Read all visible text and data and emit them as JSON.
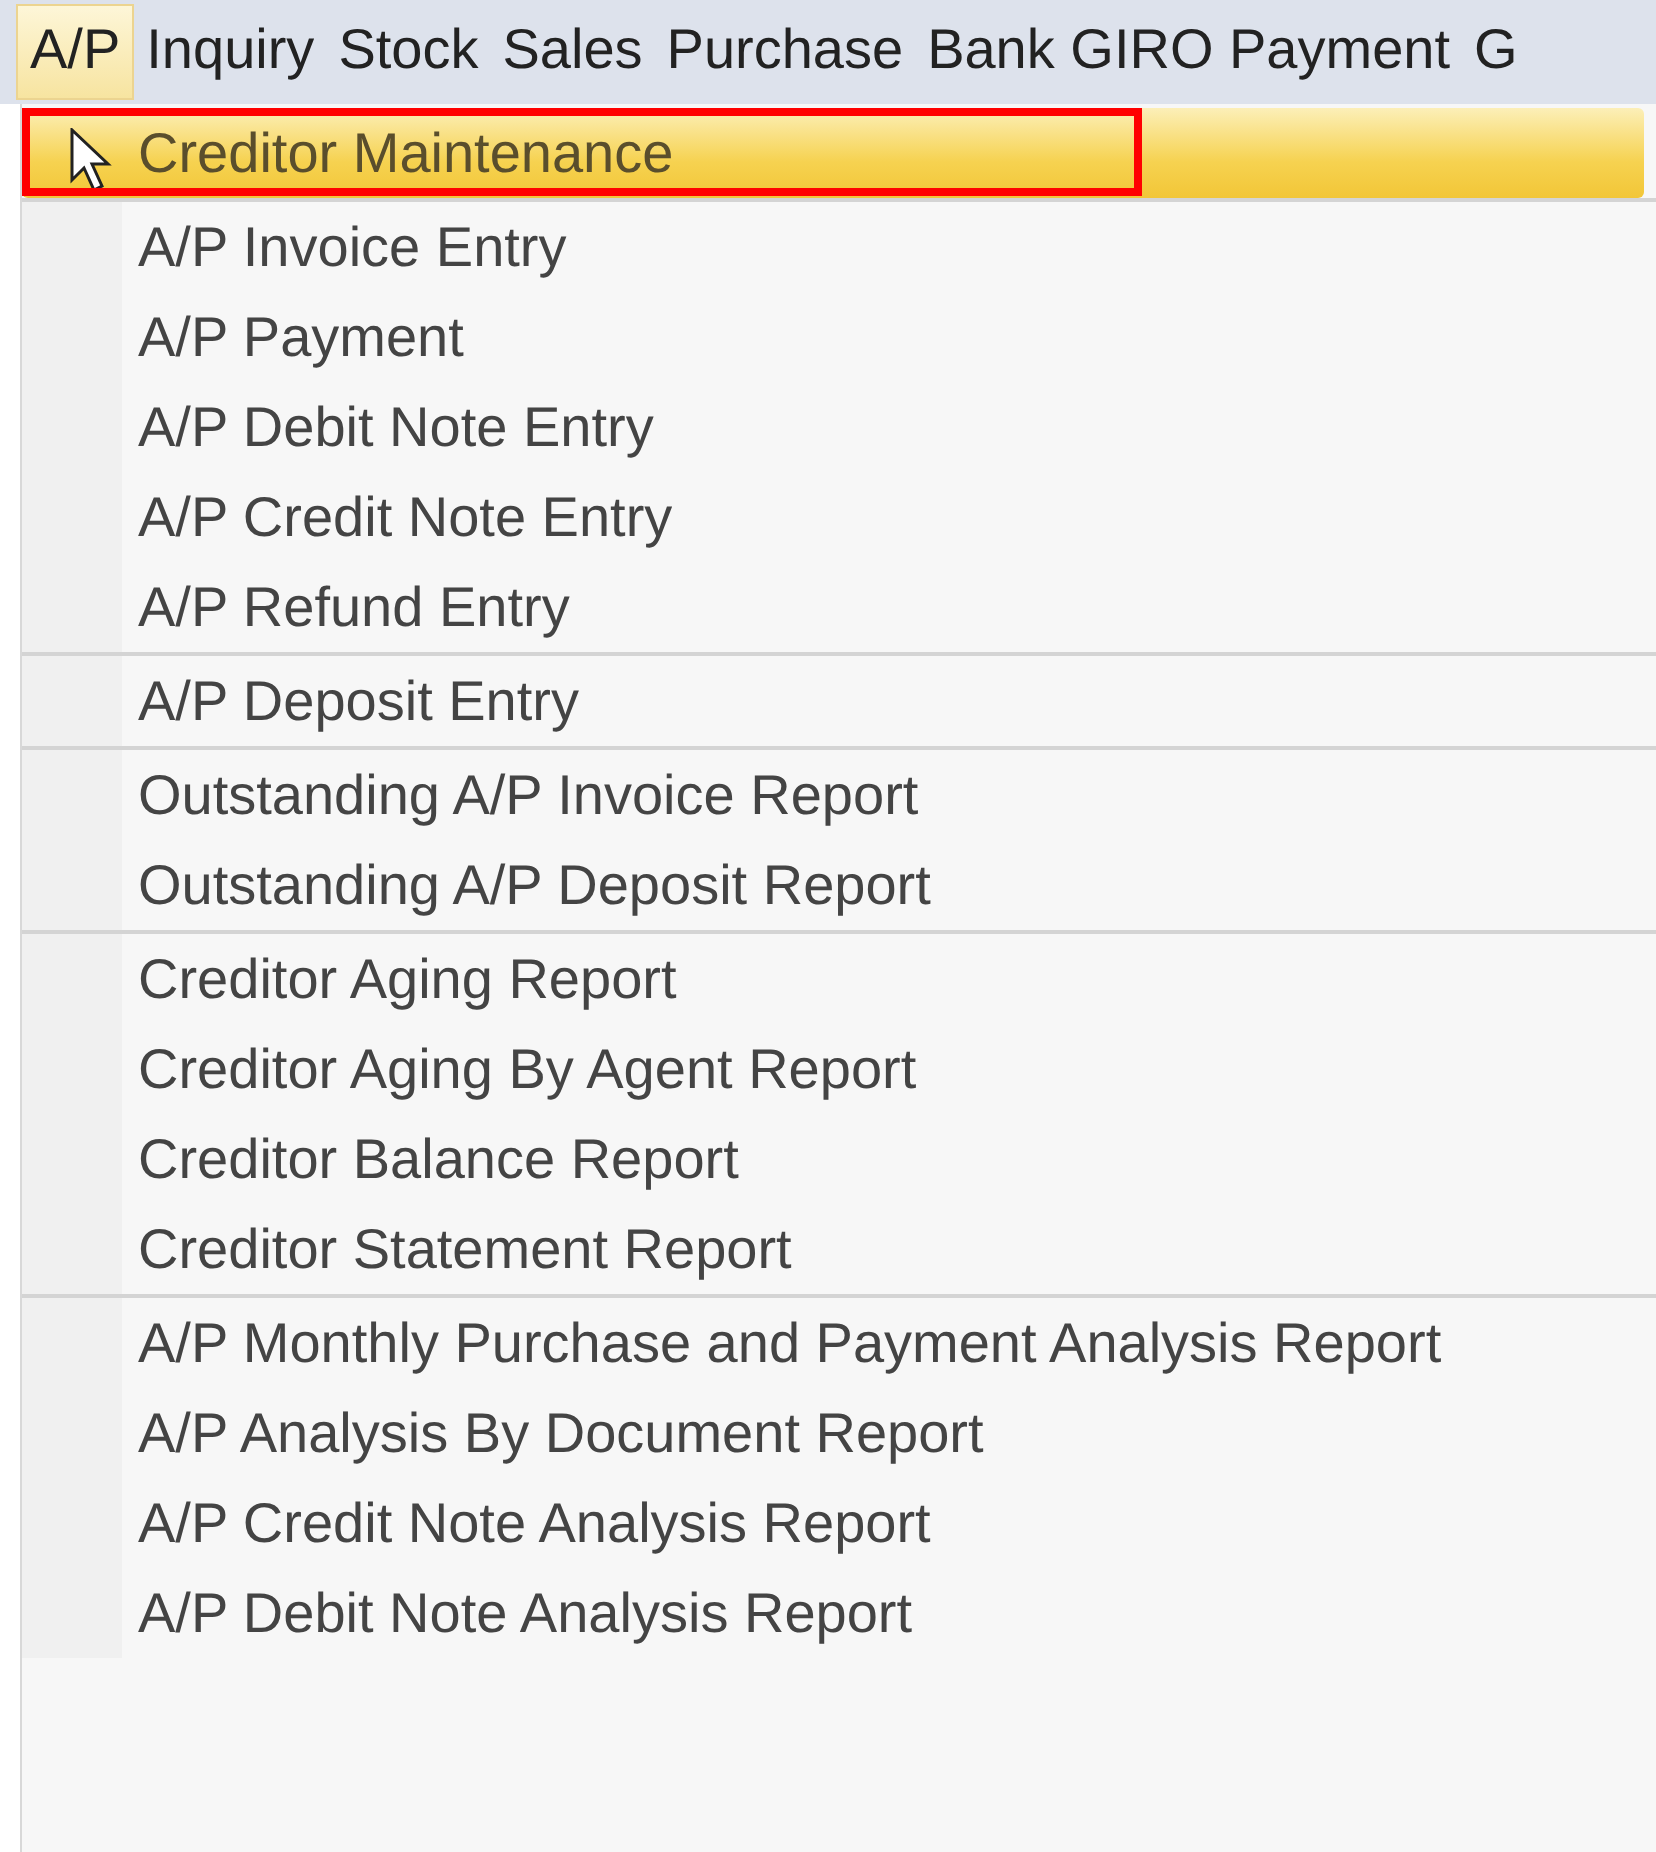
{
  "menu_bar": [
    {
      "label": "A/P",
      "selected": true
    },
    {
      "label": "Inquiry",
      "selected": false
    },
    {
      "label": "Stock",
      "selected": false
    },
    {
      "label": "Sales",
      "selected": false
    },
    {
      "label": "Purchase",
      "selected": false
    },
    {
      "label": "Bank GIRO Payment",
      "selected": false
    },
    {
      "label": "G",
      "selected": false
    }
  ],
  "menu": {
    "groups": [
      {
        "items": [
          {
            "label": "Creditor Maintenance",
            "selected": true,
            "annotated": true
          }
        ]
      },
      {
        "items": [
          {
            "label": "A/P Invoice Entry",
            "selected": false,
            "annotated": false
          },
          {
            "label": "A/P Payment",
            "selected": false,
            "annotated": false
          },
          {
            "label": "A/P Debit Note Entry",
            "selected": false,
            "annotated": false
          },
          {
            "label": "A/P Credit Note Entry",
            "selected": false,
            "annotated": false
          },
          {
            "label": "A/P Refund Entry",
            "selected": false,
            "annotated": false
          }
        ]
      },
      {
        "items": [
          {
            "label": "A/P Deposit Entry",
            "selected": false,
            "annotated": false
          }
        ]
      },
      {
        "items": [
          {
            "label": "Outstanding A/P Invoice Report",
            "selected": false,
            "annotated": false
          },
          {
            "label": "Outstanding A/P Deposit Report",
            "selected": false,
            "annotated": false
          }
        ]
      },
      {
        "items": [
          {
            "label": "Creditor Aging Report",
            "selected": false,
            "annotated": false
          },
          {
            "label": "Creditor Aging By Agent Report",
            "selected": false,
            "annotated": false
          },
          {
            "label": "Creditor Balance Report",
            "selected": false,
            "annotated": false
          },
          {
            "label": "Creditor Statement Report",
            "selected": false,
            "annotated": false
          }
        ]
      },
      {
        "items": [
          {
            "label": "A/P Monthly Purchase and Payment Analysis Report",
            "selected": false,
            "annotated": false
          },
          {
            "label": "A/P Analysis By Document Report",
            "selected": false,
            "annotated": false
          },
          {
            "label": "A/P Credit Note Analysis Report",
            "selected": false,
            "annotated": false
          },
          {
            "label": "A/P Debit Note Analysis Report",
            "selected": false,
            "annotated": false
          }
        ]
      }
    ]
  }
}
